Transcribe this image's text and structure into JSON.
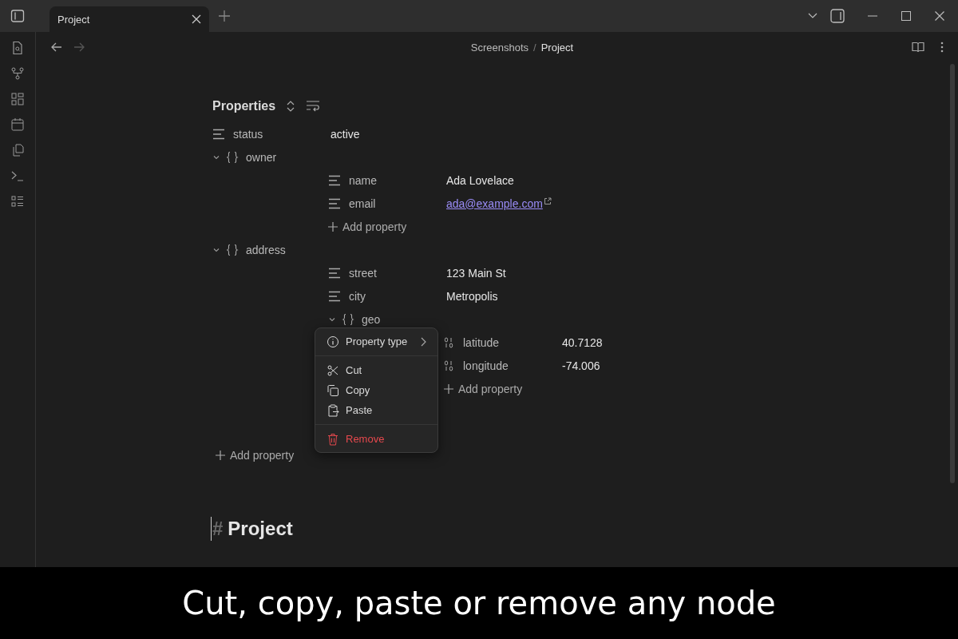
{
  "tabs": [
    {
      "title": "Project",
      "selected": true
    }
  ],
  "breadcrumb": {
    "folder": "Screenshots",
    "separator": "/",
    "note": "Project"
  },
  "properties": {
    "title": "Properties",
    "add_label": "Add property",
    "items": [
      {
        "kind": "text",
        "key": "status",
        "value": "active",
        "link": false
      },
      {
        "kind": "object",
        "key": "owner",
        "expanded": true,
        "add_label": "Add property",
        "children": [
          {
            "kind": "text",
            "key": "name",
            "value": "Ada Lovelace",
            "link": false
          },
          {
            "kind": "text",
            "key": "email",
            "value": "ada@example.com",
            "link": true
          }
        ]
      },
      {
        "kind": "object",
        "key": "address",
        "expanded": true,
        "children": [
          {
            "kind": "text",
            "key": "street",
            "value": "123 Main St",
            "link": false
          },
          {
            "kind": "text",
            "key": "city",
            "value": "Metropolis",
            "link": false
          },
          {
            "kind": "object",
            "key": "geo",
            "expanded": true,
            "add_label": "Add property",
            "children": [
              {
                "kind": "number",
                "key": "latitude",
                "value": "40.7128"
              },
              {
                "kind": "number",
                "key": "longitude",
                "value": "-74.006"
              }
            ]
          }
        ]
      }
    ]
  },
  "context_menu": {
    "groups": [
      [
        {
          "kind": "submenu",
          "label": "Property type"
        }
      ],
      [
        {
          "kind": "cut",
          "label": "Cut"
        },
        {
          "kind": "copy",
          "label": "Copy"
        },
        {
          "kind": "paste",
          "label": "Paste"
        }
      ],
      [
        {
          "kind": "delete",
          "label": "Remove"
        }
      ]
    ]
  },
  "heading": {
    "marker": "#",
    "text": "Project"
  },
  "caption": "Cut, copy, paste or remove any node"
}
